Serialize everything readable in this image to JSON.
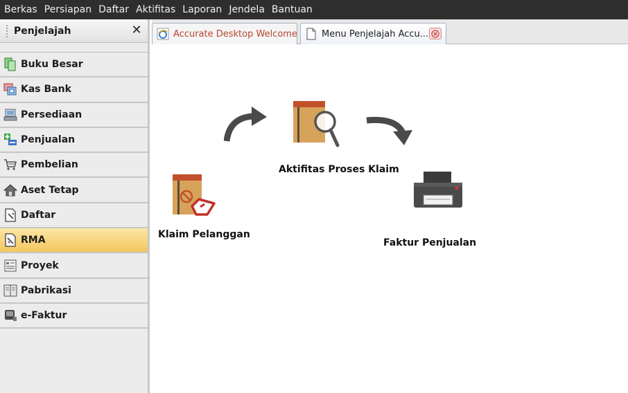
{
  "menubar": {
    "items": [
      {
        "label": "Berkas"
      },
      {
        "label": "Persiapan"
      },
      {
        "label": "Daftar"
      },
      {
        "label": "Aktifitas"
      },
      {
        "label": "Laporan"
      },
      {
        "label": "Jendela"
      },
      {
        "label": "Bantuan"
      }
    ]
  },
  "panel": {
    "title": "Penjelajah",
    "close_glyph": "✕"
  },
  "nav": {
    "items": [
      {
        "label": "Buku Besar",
        "icon": "ledger-icon"
      },
      {
        "label": "Kas Bank",
        "icon": "bank-icon"
      },
      {
        "label": "Persediaan",
        "icon": "inventory-icon"
      },
      {
        "label": "Penjualan",
        "icon": "sales-icon"
      },
      {
        "label": "Pembelian",
        "icon": "cart-icon"
      },
      {
        "label": "Aset Tetap",
        "icon": "house-icon"
      },
      {
        "label": "Daftar",
        "icon": "list-doc-icon"
      },
      {
        "label": "RMA",
        "icon": "rma-doc-icon"
      },
      {
        "label": "Proyek",
        "icon": "project-icon"
      },
      {
        "label": "Pabrikasi",
        "icon": "factory-icon"
      },
      {
        "label": "e-Faktur",
        "icon": "efaktur-icon"
      }
    ],
    "active": "RMA"
  },
  "tabs": [
    {
      "label": "Accurate Desktop Welcome...",
      "icon": "browser-icon"
    },
    {
      "label": "Menu Penjelajah Accu...",
      "icon": "page-icon"
    }
  ],
  "flow": {
    "claim": "Klaim Pelanggan",
    "process": "Aktifitas Proses Klaim",
    "invoice": "Faktur Penjualan"
  },
  "colors": {
    "menubar_bg": "#2e2e2e",
    "active_item": "#f4c75e",
    "folder": "#d7a35a",
    "folder_band": "#c2502a"
  }
}
